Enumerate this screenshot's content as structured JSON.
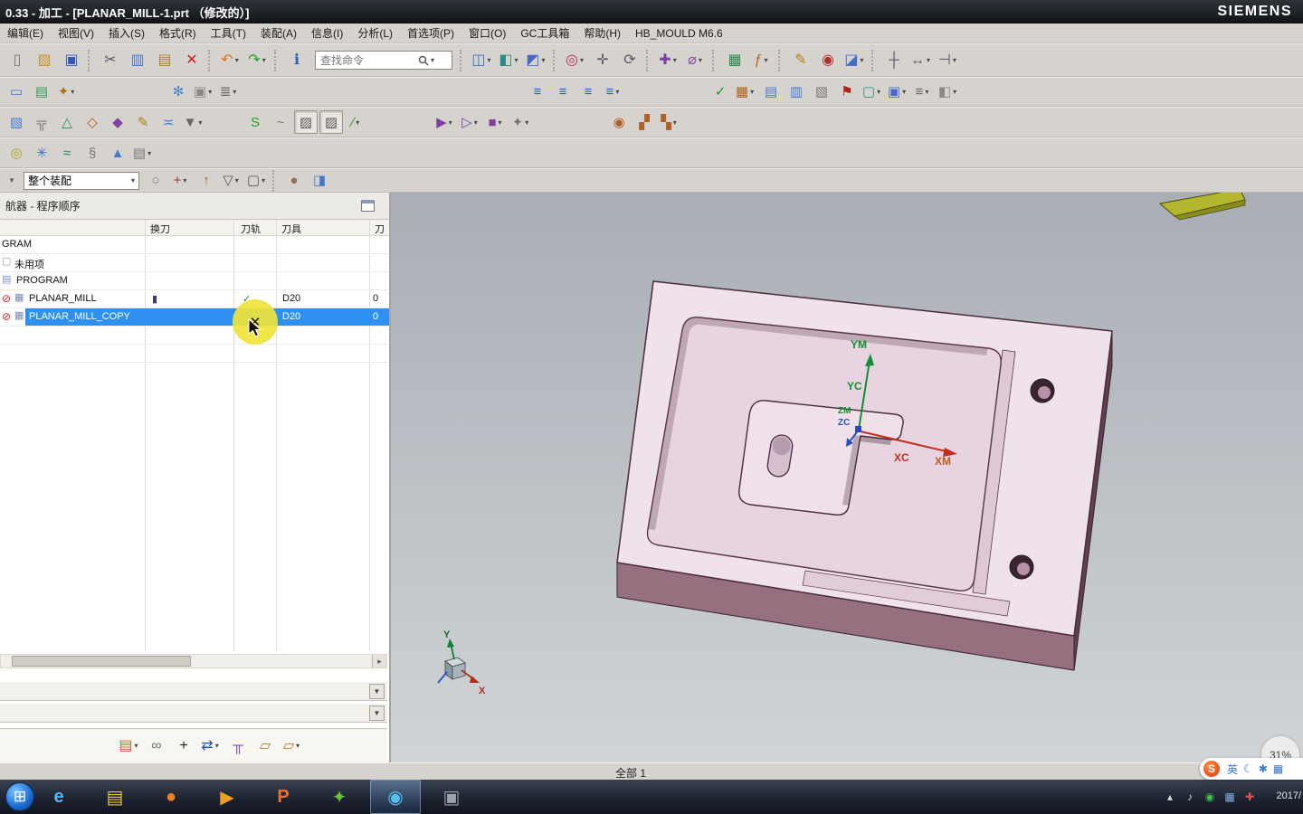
{
  "title_bar": {
    "title": "0.33 - 加工 - [PLANAR_MILL-1.prt （修改的）]",
    "brand": "SIEMENS"
  },
  "menu_bar": {
    "items": [
      {
        "n": "menu-edit",
        "t": "编辑(E)"
      },
      {
        "n": "menu-view",
        "t": "视图(V)"
      },
      {
        "n": "menu-insert",
        "t": "插入(S)"
      },
      {
        "n": "menu-format",
        "t": "格式(R)"
      },
      {
        "n": "menu-tools",
        "t": "工具(T)"
      },
      {
        "n": "menu-assemblies",
        "t": "装配(A)"
      },
      {
        "n": "menu-information",
        "t": "信息(I)"
      },
      {
        "n": "menu-analysis",
        "t": "分析(L)"
      },
      {
        "n": "menu-preferences",
        "t": "首选项(P)"
      },
      {
        "n": "menu-window",
        "t": "窗口(O)"
      },
      {
        "n": "menu-gc-toolbox",
        "t": "GC工具箱"
      },
      {
        "n": "menu-help",
        "t": "帮助(H)"
      },
      {
        "n": "menu-hb-mould",
        "t": "HB_MOULD M6.6"
      }
    ]
  },
  "toolbars": {
    "search_placeholder": "查找命令",
    "t1a": [
      {
        "n": "new-file-icon",
        "g": "▯",
        "c": "#777"
      },
      {
        "n": "open-icon",
        "g": "▨",
        "c": "#c89028"
      },
      {
        "n": "save-icon",
        "g": "▣",
        "c": "#3658b8"
      },
      {
        "s": 1
      },
      {
        "n": "cut-icon",
        "g": "✂",
        "c": "#556"
      },
      {
        "n": "copy-icon",
        "g": "▥",
        "c": "#4a78d0"
      },
      {
        "n": "paste-icon",
        "g": "▤",
        "c": "#b08030"
      },
      {
        "n": "delete-icon",
        "g": "✕",
        "c": "#c42020"
      },
      {
        "s": 1
      },
      {
        "n": "undo-icon",
        "g": "↶",
        "c": "#e07820",
        "d": 1
      },
      {
        "n": "redo-icon",
        "g": "↷",
        "c": "#28a028",
        "d": 1
      },
      {
        "s": 1
      },
      {
        "n": "command-finder-icon",
        "g": "ℹ",
        "c": "#2060c0"
      }
    ],
    "t1b": [
      {
        "s": 1
      },
      {
        "n": "window-layout-icon",
        "g": "◫",
        "c": "#3a70c8",
        "d": 1
      },
      {
        "n": "render-style-icon",
        "g": "◧",
        "c": "#2a8a8a",
        "d": 1
      },
      {
        "n": "orient-view-icon",
        "g": "◩",
        "c": "#4a68c8",
        "d": 1
      },
      {
        "s": 1
      },
      {
        "n": "show-hide-icon",
        "g": "◎",
        "c": "#b03060",
        "d": 1
      },
      {
        "n": "pan-view-icon",
        "g": "✛",
        "c": "#556"
      },
      {
        "n": "rotate-view-icon",
        "g": "⟳",
        "c": "#556"
      },
      {
        "s": 1
      },
      {
        "n": "snap-point-icon",
        "g": "✚",
        "c": "#8040a0",
        "d": 1
      },
      {
        "n": "measure-distance-icon",
        "g": "⌀",
        "c": "#9040b0",
        "d": 1
      },
      {
        "s": 1
      },
      {
        "n": "spreadsheet-icon",
        "g": "▦",
        "c": "#2a8a4a"
      },
      {
        "n": "expression-icon",
        "g": "ƒ",
        "c": "#b06820",
        "d": 1
      },
      {
        "s": 1
      },
      {
        "n": "annotate-icon",
        "g": "✎",
        "c": "#b08020"
      },
      {
        "n": "record-macro-icon",
        "g": "◉",
        "c": "#b03030"
      },
      {
        "n": "touch-mode-icon",
        "g": "◪",
        "c": "#3a70c8",
        "d": 1
      },
      {
        "s": 1
      },
      {
        "n": "point-constructor-icon",
        "g": "┼",
        "c": "#556"
      },
      {
        "n": "dimension-icon",
        "g": "↔",
        "c": "#556",
        "d": 1
      },
      {
        "n": "list-end-icon",
        "g": "⊣",
        "c": "#556",
        "d": 1
      }
    ],
    "t2": [
      {
        "n": "dialog-rail-icon",
        "g": "▭",
        "c": "#4a78d0"
      },
      {
        "n": "roles-icon",
        "g": "▤",
        "c": "#3a9a5a"
      },
      {
        "n": "user-prefs-icon",
        "g": "✦",
        "c": "#b07020",
        "d": 1
      },
      {
        "sp": 95
      },
      {
        "n": "refresh-view-icon",
        "g": "✻",
        "c": "#4a88c8"
      },
      {
        "n": "fit-window-icon",
        "g": "▣",
        "c": "#888",
        "d": 1
      },
      {
        "n": "layer-settings-icon",
        "g": "≣",
        "c": "#666",
        "d": 1
      },
      {
        "sp": 313
      },
      {
        "n": "program-order-view-icon",
        "g": "≡",
        "c": "#2a60c0"
      },
      {
        "n": "machine-tool-view-icon",
        "g": "≡",
        "c": "#2a60c0"
      },
      {
        "n": "geometry-view-icon",
        "g": "≡",
        "c": "#2a60c0"
      },
      {
        "n": "method-view-icon",
        "g": "≡",
        "c": "#2a60c0",
        "d": 1
      },
      {
        "sp": 90
      },
      {
        "n": "generate-toolpath-icon",
        "g": "✓",
        "c": "#18981a"
      },
      {
        "n": "verify-toolpath-icon",
        "g": "▦",
        "c": "#b06020",
        "d": 1
      },
      {
        "n": "list-toolpath-icon",
        "g": "▤",
        "c": "#4a78d0"
      },
      {
        "n": "postprocess-icon",
        "g": "▥",
        "c": "#4a78d0"
      },
      {
        "n": "shop-doc-icon",
        "g": "▧",
        "c": "#777"
      },
      {
        "n": "progress-flag-icon",
        "g": "⚑",
        "c": "#b02020"
      },
      {
        "n": "simulate-machine-icon",
        "g": "▢",
        "c": "#2a8a8a",
        "d": 1
      },
      {
        "n": "display-toolpath-icon",
        "g": "▣",
        "c": "#4a68c8",
        "d": 1
      },
      {
        "n": "tool-library-icon",
        "g": "≡",
        "c": "#666",
        "d": 1
      },
      {
        "n": "machine-nav-icon",
        "g": "◧",
        "c": "#888",
        "d": 1
      }
    ],
    "t3": [
      {
        "n": "create-program-icon",
        "g": "▧",
        "c": "#4a78d0"
      },
      {
        "n": "create-tool-icon",
        "g": "╦",
        "c": "#777"
      },
      {
        "n": "create-geometry-icon",
        "g": "△",
        "c": "#2a8a5a"
      },
      {
        "n": "create-method-icon",
        "g": "◇",
        "c": "#b06020"
      },
      {
        "n": "create-operation-icon",
        "g": "◆",
        "c": "#8040a0"
      },
      {
        "n": "edit-operation-icon",
        "g": "✎",
        "c": "#b08020"
      },
      {
        "n": "cut-levels-icon",
        "g": "≍",
        "c": "#4a78d0"
      },
      {
        "n": "object-display-icon",
        "g": "▼",
        "c": "#666",
        "d": 1
      },
      {
        "sp": 40
      },
      {
        "n": "curve-tool-icon",
        "g": "S",
        "c": "#28a028"
      },
      {
        "n": "spline-tool-icon",
        "g": "~",
        "c": "#777"
      },
      {
        "n": "boundary-hatch-icon",
        "g": "▨",
        "c": "#555",
        "a": 1
      },
      {
        "n": "area-hatch-icon",
        "g": "▨",
        "c": "#555",
        "a": 1
      },
      {
        "n": "edit-ruler-icon",
        "g": "∕",
        "c": "#28a028",
        "d": 1
      },
      {
        "sp": 70
      },
      {
        "n": "replay-path-icon",
        "g": "▶",
        "c": "#8040a0",
        "d": 1
      },
      {
        "n": "step-path-icon",
        "g": "▷",
        "c": "#8040a0",
        "d": 1
      },
      {
        "n": "gouge-check-icon",
        "g": "■",
        "c": "#8040a0",
        "d": 1
      },
      {
        "n": "path-tools-icon",
        "g": "✦",
        "c": "#777",
        "d": 1
      },
      {
        "sp": 80
      },
      {
        "n": "mill-axis-icon",
        "g": "◉",
        "c": "#b06020"
      },
      {
        "n": "machine-model-icon",
        "g": "▞",
        "c": "#b06020"
      },
      {
        "n": "nc-assistant-icon",
        "g": "▚",
        "c": "#b06020",
        "d": 1
      }
    ],
    "t4": [
      {
        "n": "show-tool-icon",
        "g": "◎",
        "c": "#b0a020"
      },
      {
        "n": "tool-axis-icon",
        "g": "✳",
        "c": "#3a70c8"
      },
      {
        "n": "feed-rates-icon",
        "g": "≈",
        "c": "#2a8a5a"
      },
      {
        "n": "corner-control-icon",
        "g": "§",
        "c": "#777"
      },
      {
        "n": "clearance-icon",
        "g": "▲",
        "c": "#4a78d0"
      },
      {
        "n": "operation-notes-icon",
        "g": "▤",
        "c": "#777",
        "d": 1
      }
    ],
    "ctx_icons": [
      {
        "n": "general-selection-icon",
        "g": "○",
        "c": "#777"
      },
      {
        "n": "snap-plus-icon",
        "g": "+",
        "c": "#b03030",
        "d": 1
      },
      {
        "n": "select-parent-icon",
        "g": "↑",
        "c": "#b06020"
      },
      {
        "n": "filter-face-icon",
        "g": "▽",
        "c": "#556",
        "d": 1
      },
      {
        "n": "rectangle-select-icon",
        "g": "▢",
        "c": "#556",
        "d": 1
      },
      {
        "s": 1
      },
      {
        "n": "highlight-sphere-icon",
        "g": "●",
        "c": "#907050"
      },
      {
        "n": "solid-cube-icon",
        "g": "◨",
        "c": "#4a78d0"
      }
    ],
    "nav_tools": [
      {
        "n": "find-object-icon",
        "g": "▤",
        "c": "#d06030",
        "d": 1
      },
      {
        "n": "object-link-icon",
        "g": "∞",
        "c": "#707070"
      },
      {
        "n": "expand-all-icon",
        "g": "+",
        "c": "#222"
      },
      {
        "n": "transform-icon",
        "g": "⇄",
        "c": "#2050c0",
        "d": 1
      },
      {
        "n": "tool-column-icon",
        "g": "╥",
        "c": "#8050a0"
      },
      {
        "n": "stock-display-icon",
        "g": "▱",
        "c": "#b08030"
      },
      {
        "n": "workpiece-display-icon",
        "g": "▱",
        "c": "#b08030",
        "d": 1
      }
    ]
  },
  "context_bar": {
    "assembly_scope": "整个装配"
  },
  "navigator": {
    "title": "航器 - 程序顺序",
    "columns": [
      "换刀",
      "刀轨",
      "刀具",
      "刀"
    ],
    "rows": [
      {
        "label": "GRAM"
      },
      {
        "label": "未用项"
      },
      {
        "label": "PROGRAM"
      },
      {
        "label": "PLANAR_MILL",
        "toolchange": "▮",
        "path_ok": "✓",
        "tool": "D20",
        "count": "0"
      },
      {
        "label": "PLANAR_MILL_COPY",
        "path_ok": "✕",
        "tool": "D20",
        "count": "0"
      }
    ]
  },
  "viewport": {
    "labels": {
      "ym": "YM",
      "yc": "YC",
      "zm": "ZM",
      "zc": "ZC",
      "xc": "XC",
      "xm": "XM",
      "triad_x": "X",
      "triad_y": "Y"
    }
  },
  "status_bar": {
    "text": "全部  1"
  },
  "overlays": {
    "battery": "31%",
    "ime_lang": "英",
    "ime_logo": "S"
  },
  "taskbar": {
    "clock": "2017/",
    "apps": [
      {
        "n": "taskbar-ie-icon",
        "g": "e",
        "c": "#5ab4f0"
      },
      {
        "n": "taskbar-explorer-icon",
        "g": "▤",
        "c": "#e8c05a"
      },
      {
        "n": "taskbar-firefox-icon",
        "g": "●",
        "c": "#f08020"
      },
      {
        "n": "taskbar-player-icon",
        "g": "▶",
        "c": "#f0a020"
      },
      {
        "n": "taskbar-powerpoint-icon",
        "g": "P",
        "c": "#f07030"
      },
      {
        "n": "taskbar-keywiz-icon",
        "g": "✦",
        "c": "#70c040"
      },
      {
        "n": "taskbar-nx-icon",
        "g": "◉",
        "c": "#58c0f0",
        "a": 1
      },
      {
        "n": "taskbar-modeler-icon",
        "g": "▣",
        "c": "#9aa2ac"
      }
    ],
    "tray": [
      {
        "n": "tray-expand-icon",
        "g": "▴",
        "c": "#d8d8d8"
      },
      {
        "n": "tray-volume-icon",
        "g": "♪",
        "c": "#d8d8d8"
      },
      {
        "n": "tray-safety-icon",
        "g": "◉",
        "c": "#40c050"
      },
      {
        "n": "tray-network-icon",
        "g": "▦",
        "c": "#80b0e0"
      },
      {
        "n": "tray-av-icon",
        "g": "✚",
        "c": "#e05050"
      }
    ]
  }
}
